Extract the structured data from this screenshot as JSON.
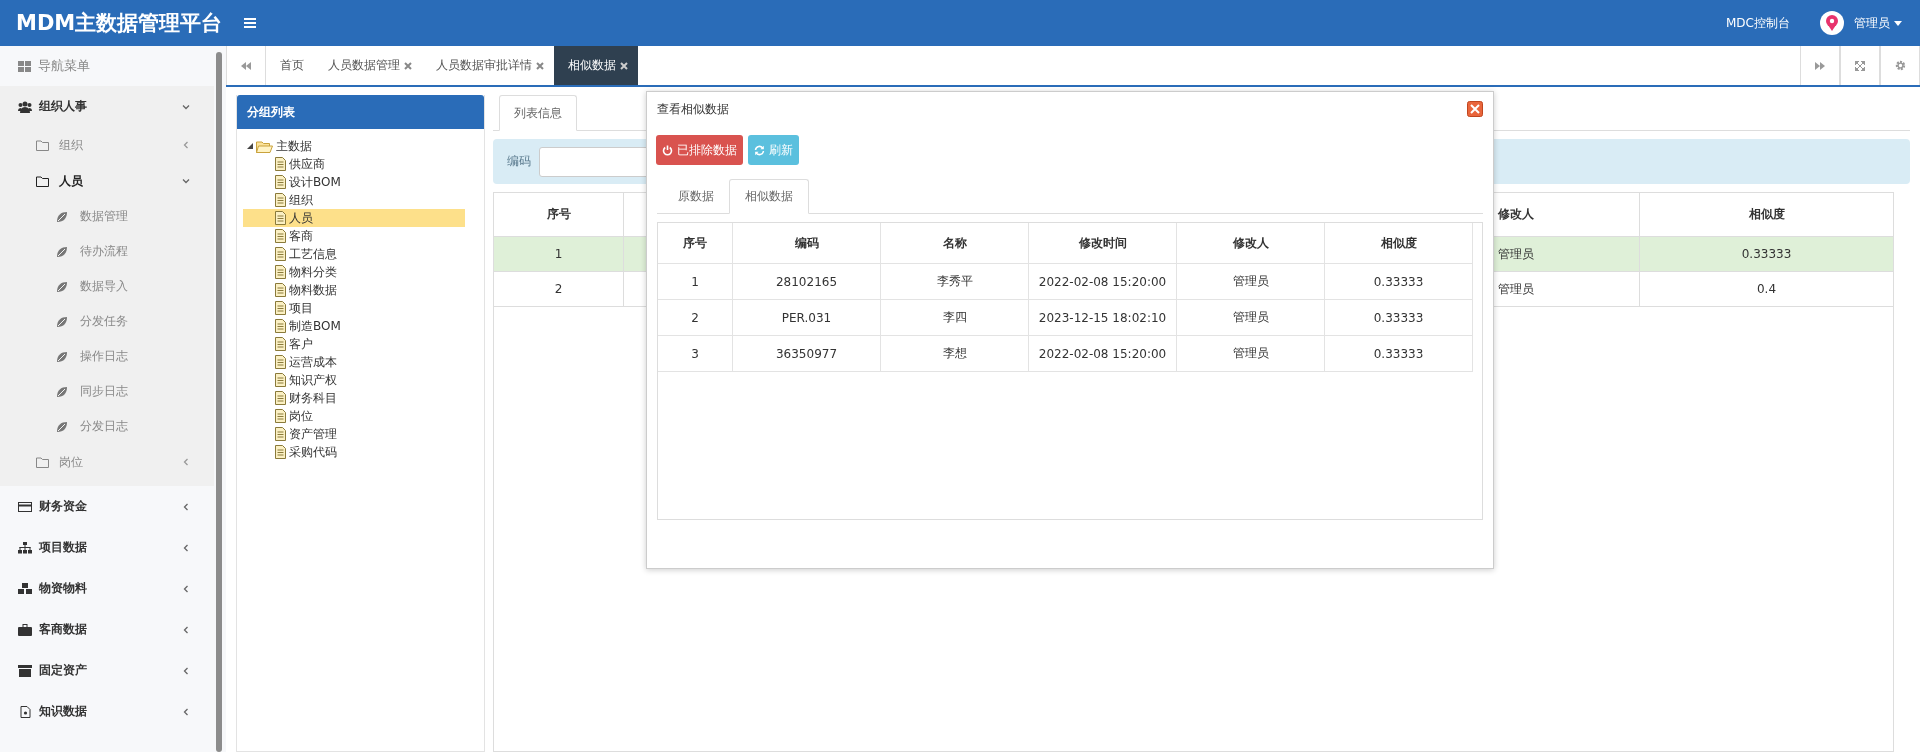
{
  "header": {
    "title": "MDM主数据管理平台",
    "console_link": "MDC控制台",
    "user": "管理员"
  },
  "sidebar": {
    "title": "导航菜单",
    "items": [
      {
        "label": "组织人事",
        "expanded": true,
        "children": [
          {
            "label": "组织",
            "expanded": false
          },
          {
            "label": "人员",
            "expanded": true,
            "children": [
              {
                "label": "数据管理"
              },
              {
                "label": "待办流程"
              },
              {
                "label": "数据导入"
              },
              {
                "label": "分发任务"
              },
              {
                "label": "操作日志"
              },
              {
                "label": "同步日志"
              },
              {
                "label": "分发日志"
              }
            ]
          },
          {
            "label": "岗位",
            "expanded": false
          }
        ]
      },
      {
        "label": "财务资金",
        "expanded": false
      },
      {
        "label": "项目数据",
        "expanded": false
      },
      {
        "label": "物资物料",
        "expanded": false
      },
      {
        "label": "客商数据",
        "expanded": false
      },
      {
        "label": "固定资产",
        "expanded": false
      },
      {
        "label": "知识数据",
        "expanded": false
      }
    ]
  },
  "page_tabs": [
    {
      "label": "首页",
      "closable": false,
      "selected": false
    },
    {
      "label": "人员数据管理",
      "closable": true,
      "selected": false
    },
    {
      "label": "人员数据审批详情",
      "closable": true,
      "selected": false
    },
    {
      "label": "相似数据",
      "closable": true,
      "selected": true
    }
  ],
  "group_tree": {
    "title": "分组列表",
    "root": {
      "label": "主数据",
      "expanded": true,
      "children": [
        {
          "label": "供应商",
          "selected": false
        },
        {
          "label": "设计BOM",
          "selected": false
        },
        {
          "label": "组织",
          "selected": false
        },
        {
          "label": "人员",
          "selected": true
        },
        {
          "label": "客商",
          "selected": false
        },
        {
          "label": "工艺信息",
          "selected": false
        },
        {
          "label": "物料分类",
          "selected": false
        },
        {
          "label": "物料数据",
          "selected": false
        },
        {
          "label": "项目",
          "selected": false
        },
        {
          "label": "制造BOM",
          "selected": false
        },
        {
          "label": "客户",
          "selected": false
        },
        {
          "label": "运营成本",
          "selected": false
        },
        {
          "label": "知识产权",
          "selected": false
        },
        {
          "label": "财务科目",
          "selected": false
        },
        {
          "label": "岗位",
          "selected": false
        },
        {
          "label": "资产管理",
          "selected": false
        },
        {
          "label": "采购代码",
          "selected": false
        }
      ]
    }
  },
  "list_panel": {
    "tabs": [
      {
        "label": "列表信息",
        "selected": true
      }
    ],
    "search": {
      "label": "编码"
    },
    "table": {
      "columns": [
        "序号",
        "修改人",
        "相似度"
      ],
      "rows": [
        {
          "cells": [
            "1",
            "管理员",
            "0.33333"
          ],
          "selected": true
        },
        {
          "cells": [
            "2",
            "管理员",
            "0.4"
          ],
          "selected": false
        }
      ]
    }
  },
  "dialog": {
    "title": "查看相似数据",
    "buttons": [
      {
        "label": "已排除数据",
        "kind": "danger"
      },
      {
        "label": "刷新",
        "kind": "info"
      }
    ],
    "tabs": [
      {
        "label": "原数据",
        "selected": false
      },
      {
        "label": "相似数据",
        "selected": true
      }
    ],
    "table": {
      "columns": [
        "序号",
        "编码",
        "名称",
        "修改时间",
        "修改人",
        "相似度"
      ],
      "rows": [
        [
          "1",
          "28102165",
          "李秀平",
          "2022-02-08 15:20:00",
          "管理员",
          "0.33333"
        ],
        [
          "2",
          "PER.031",
          "李四",
          "2023-12-15 18:02:10",
          "管理员",
          "0.33333"
        ],
        [
          "3",
          "36350977",
          "李想",
          "2022-02-08 15:20:00",
          "管理员",
          "0.33333"
        ]
      ]
    }
  }
}
